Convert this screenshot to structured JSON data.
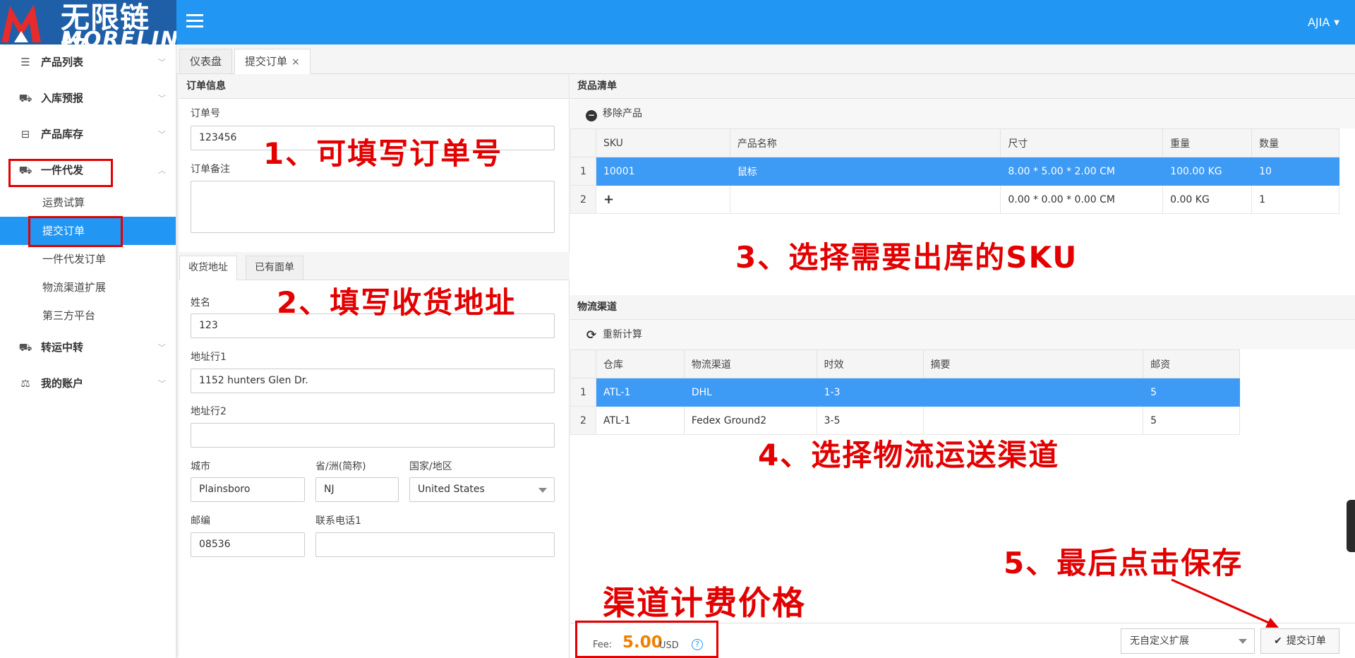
{
  "brand": {
    "cn": "无限链接",
    "en": "MORELINK"
  },
  "header": {
    "user": "AJIA"
  },
  "sidebar": {
    "items": [
      {
        "label": "产品列表",
        "icon": "list-icon"
      },
      {
        "label": "入库预报",
        "icon": "inbound-icon"
      },
      {
        "label": "产品库存",
        "icon": "inbox-icon"
      },
      {
        "label": "一件代发",
        "icon": "truck-icon"
      }
    ],
    "subitems": [
      "运费试算",
      "提交订单",
      "一件代发订单",
      "物流渠道扩展",
      "第三方平台"
    ],
    "items2": [
      {
        "label": "转运中转",
        "icon": "truck-icon"
      },
      {
        "label": "我的账户",
        "icon": "balance-icon"
      }
    ]
  },
  "tabs": [
    {
      "label": "仪表盘"
    },
    {
      "label": "提交订单"
    }
  ],
  "order_info": {
    "title": "订单信息",
    "order_no_label": "订单号",
    "order_no": "123456",
    "remark_label": "订单备注",
    "remark": ""
  },
  "address_tabs": [
    "收货地址",
    "已有面单"
  ],
  "address": {
    "name_label": "姓名",
    "name": "123",
    "addr1_label": "地址行1",
    "addr1": "1152 hunters Glen Dr.",
    "addr2_label": "地址行2",
    "addr2": "",
    "city_label": "城市",
    "city": "Plainsboro",
    "state_label": "省/洲(简称)",
    "state": "NJ",
    "country_label": "国家/地区",
    "country": "United States",
    "zip_label": "邮编",
    "zip": "08536",
    "phone_label": "联系电话1",
    "phone": ""
  },
  "goods": {
    "title": "货品清单",
    "remove_label": "移除产品",
    "columns": [
      "SKU",
      "产品名称",
      "尺寸",
      "重量",
      "数量"
    ],
    "rows": [
      {
        "no": "1",
        "sku": "10001",
        "name": "鼠标",
        "size": "8.00 * 5.00 * 2.00 CM",
        "weight": "100.00 KG",
        "qty": "10"
      },
      {
        "no": "2",
        "sku": "+",
        "name": "",
        "size": "0.00 * 0.00 * 0.00 CM",
        "weight": "0.00 KG",
        "qty": "1"
      }
    ]
  },
  "logistics": {
    "title": "物流渠道",
    "recalc_label": "重新计算",
    "columns": [
      "仓库",
      "物流渠道",
      "时效",
      "摘要",
      "邮资"
    ],
    "rows": [
      {
        "no": "1",
        "warehouse": "ATL-1",
        "channel": "DHL",
        "time": "1-3",
        "summary": "",
        "postage": "5"
      },
      {
        "no": "2",
        "warehouse": "ATL-1",
        "channel": "Fedex Ground2",
        "time": "3-5",
        "summary": "",
        "postage": "5"
      }
    ]
  },
  "footer": {
    "fee_label": "Fee:",
    "fee_value": "5.00",
    "currency": "USD",
    "help": "?",
    "ext_select": "无自定义扩展",
    "submit_label": "提交订单"
  },
  "annotations": {
    "step1": "1、可填写订单号",
    "step2": "2、填写收货地址",
    "step3": "3、选择需要出库的SKU",
    "step4": "4、选择物流运送渠道",
    "step5": "5、最后点击保存",
    "fee_note": "渠道计费价格"
  },
  "colors": {
    "primary": "#2196f3",
    "selected_row": "#3d9af5",
    "annotation": "#e30000",
    "fee": "#f08000"
  }
}
